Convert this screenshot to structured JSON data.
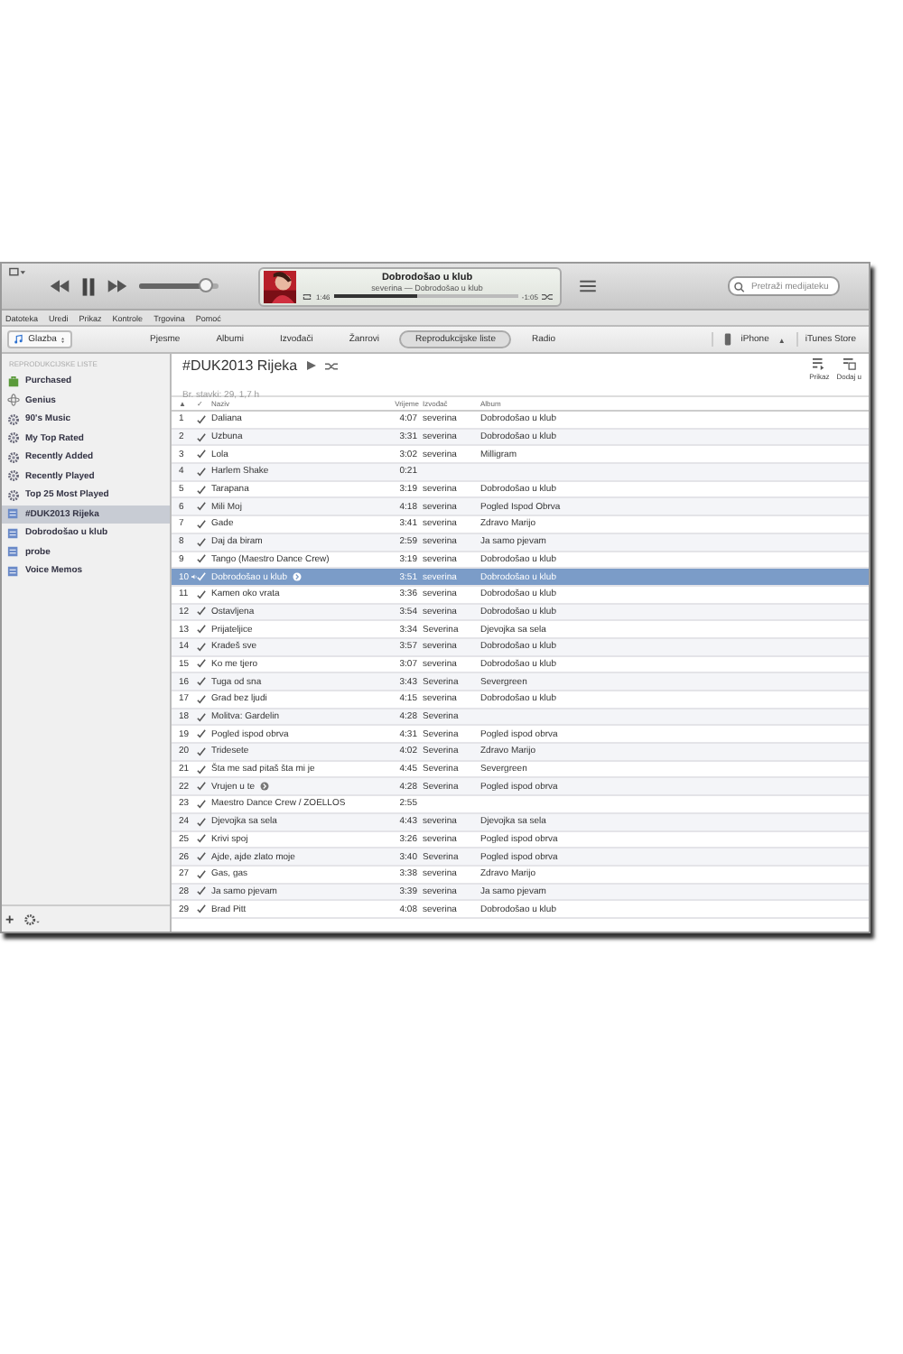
{
  "player": {
    "volume": {
      "level": 0.85
    },
    "now_playing": {
      "title": "Dobrodošao u klub",
      "subtitle": "severina — Dobrodošao u klub",
      "elapsed": "1:46",
      "remaining": "-1:05",
      "progress": {
        "level": 0.45
      }
    },
    "search": {
      "placeholder": "Pretraži medijateku"
    }
  },
  "menu": [
    "Datoteka",
    "Uredi",
    "Prikaz",
    "Kontrole",
    "Trgovina",
    "Pomoć"
  ],
  "library": {
    "label": "Glazba"
  },
  "nav_tabs": [
    {
      "label": "Pjesme",
      "selected": false
    },
    {
      "label": "Albumi",
      "selected": false
    },
    {
      "label": "Izvođači",
      "selected": false
    },
    {
      "label": "Žanrovi",
      "selected": false
    },
    {
      "label": "Reprodukcijske liste",
      "selected": true
    },
    {
      "label": "Radio",
      "selected": false
    }
  ],
  "device": {
    "label": "iPhone",
    "eject": "▲"
  },
  "store": {
    "label": "iTunes Store"
  },
  "sidebar": {
    "heading": "REPRODUKCIJSKE LISTE",
    "items": [
      {
        "label": "Purchased",
        "kind": "purchased",
        "selected": false
      },
      {
        "label": "Genius",
        "kind": "genius",
        "selected": false
      },
      {
        "label": "90's Music",
        "kind": "smart",
        "selected": false
      },
      {
        "label": "My Top Rated",
        "kind": "smart",
        "selected": false
      },
      {
        "label": "Recently Added",
        "kind": "smart",
        "selected": false
      },
      {
        "label": "Recently Played",
        "kind": "smart",
        "selected": false
      },
      {
        "label": "Top 25 Most Played",
        "kind": "smart",
        "selected": false
      },
      {
        "label": "#DUK2013 Rijeka",
        "kind": "playlist",
        "selected": true
      },
      {
        "label": "Dobrodošao u klub",
        "kind": "playlist",
        "selected": false
      },
      {
        "label": "probe",
        "kind": "playlist",
        "selected": false
      },
      {
        "label": "Voice Memos",
        "kind": "playlist",
        "selected": false
      }
    ],
    "add": "+"
  },
  "playlist": {
    "title": "#DUK2013 Rijeka",
    "info": "Br. stavki: 29, 1,7 h",
    "actions": [
      "Prikaz",
      "Dodaj u"
    ]
  },
  "table": {
    "columns": [
      "▲",
      "✓",
      "Naziv",
      "Vrijeme",
      "Izvođač",
      "Album"
    ],
    "rows": [
      {
        "n": "1",
        "name": "Daliana",
        "time": "4:07",
        "artist": "severina",
        "album": "Dobrodošao u klub",
        "checked": true,
        "selected": false,
        "playing": false,
        "arrow": false
      },
      {
        "n": "2",
        "name": "Uzbuna",
        "time": "3:31",
        "artist": "severina",
        "album": "Dobrodošao u klub",
        "checked": true,
        "selected": false,
        "playing": false,
        "arrow": false
      },
      {
        "n": "3",
        "name": "Lola",
        "time": "3:02",
        "artist": "severina",
        "album": "Milligram",
        "checked": true,
        "selected": false,
        "playing": false,
        "arrow": false
      },
      {
        "n": "4",
        "name": "Harlem Shake",
        "time": "0:21",
        "checked": true,
        "selected": false,
        "playing": false,
        "arrow": false
      },
      {
        "n": "5",
        "name": "Tarapana",
        "time": "3:19",
        "artist": "severina",
        "album": "Dobrodošao u klub",
        "checked": true,
        "selected": false,
        "playing": false,
        "arrow": false
      },
      {
        "n": "6",
        "name": "Mili Moj",
        "time": "4:18",
        "artist": "severina",
        "album": "Pogled Ispod Obrva",
        "checked": true,
        "selected": false,
        "playing": false,
        "arrow": false
      },
      {
        "n": "7",
        "name": "Gade",
        "time": "3:41",
        "artist": "severina",
        "album": "Zdravo Marijo",
        "checked": true,
        "selected": false,
        "playing": false,
        "arrow": false
      },
      {
        "n": "8",
        "name": "Daj da biram",
        "time": "2:59",
        "artist": "severina",
        "album": "Ja samo pjevam",
        "checked": true,
        "selected": false,
        "playing": false,
        "arrow": false
      },
      {
        "n": "9",
        "name": "Tango (Maestro Dance Crew)",
        "time": "3:19",
        "artist": "severina",
        "album": "Dobrodošao u klub",
        "checked": true,
        "selected": false,
        "playing": false,
        "arrow": false
      },
      {
        "n": "10",
        "name": "Dobrodošao u klub",
        "time": "3:51",
        "artist": "severina",
        "album": "Dobrodošao u klub",
        "checked": true,
        "selected": true,
        "playing": true,
        "arrow": true
      },
      {
        "n": "11",
        "name": "Kamen oko vrata",
        "time": "3:36",
        "artist": "severina",
        "album": "Dobrodošao u klub",
        "checked": true,
        "selected": false,
        "playing": false,
        "arrow": false
      },
      {
        "n": "12",
        "name": "Ostavljena",
        "time": "3:54",
        "artist": "severina",
        "album": "Dobrodošao u klub",
        "checked": true,
        "selected": false,
        "playing": false,
        "arrow": false
      },
      {
        "n": "13",
        "name": "Prijateljice",
        "time": "3:34",
        "artist": "Severina",
        "album": "Djevojka sa sela",
        "checked": true,
        "selected": false,
        "playing": false,
        "arrow": false
      },
      {
        "n": "14",
        "name": "Kradeš sve",
        "time": "3:57",
        "artist": "severina",
        "album": "Dobrodošao u klub",
        "checked": true,
        "selected": false,
        "playing": false,
        "arrow": false
      },
      {
        "n": "15",
        "name": "Ko me tjero",
        "time": "3:07",
        "artist": "severina",
        "album": "Dobrodošao u klub",
        "checked": true,
        "selected": false,
        "playing": false,
        "arrow": false
      },
      {
        "n": "16",
        "name": "Tuga od sna",
        "time": "3:43",
        "artist": "Severina",
        "album": "Severgreen",
        "checked": true,
        "selected": false,
        "playing": false,
        "arrow": false
      },
      {
        "n": "17",
        "name": "Grad bez ljudi",
        "time": "4:15",
        "artist": "severina",
        "album": "Dobrodošao u klub",
        "checked": true,
        "selected": false,
        "playing": false,
        "arrow": false
      },
      {
        "n": "18",
        "name": "Molitva: Gardelin",
        "time": "4:28",
        "artist": "Severina",
        "checked": true,
        "selected": false,
        "playing": false,
        "arrow": false
      },
      {
        "n": "19",
        "name": "Pogled ispod obrva",
        "time": "4:31",
        "artist": "Severina",
        "album": "Pogled ispod obrva",
        "checked": true,
        "selected": false,
        "playing": false,
        "arrow": false
      },
      {
        "n": "20",
        "name": "Tridesete",
        "time": "4:02",
        "artist": "Severina",
        "album": "Zdravo Marijo",
        "checked": true,
        "selected": false,
        "playing": false,
        "arrow": false
      },
      {
        "n": "21",
        "name": "Šta me sad pitaš šta mi je",
        "time": "4:45",
        "artist": "Severina",
        "album": "Severgreen",
        "checked": true,
        "selected": false,
        "playing": false,
        "arrow": false
      },
      {
        "n": "22",
        "name": "Vrujen u te",
        "time": "4:28",
        "artist": "Severina",
        "album": "Pogled ispod obrva",
        "checked": true,
        "selected": false,
        "playing": false,
        "arrow": true
      },
      {
        "n": "23",
        "name": "Maestro Dance Crew / ZOELLOS",
        "time": "2:55",
        "checked": true,
        "selected": false,
        "playing": false,
        "arrow": false
      },
      {
        "n": "24",
        "name": "Djevojka sa sela",
        "time": "4:43",
        "artist": "severina",
        "album": "Djevojka sa sela",
        "checked": true,
        "selected": false,
        "playing": false,
        "arrow": false
      },
      {
        "n": "25",
        "name": "Krivi spoj",
        "time": "3:26",
        "artist": "severina",
        "album": "Pogled ispod obrva",
        "checked": true,
        "selected": false,
        "playing": false,
        "arrow": false
      },
      {
        "n": "26",
        "name": "Ajde, ajde zlato moje",
        "time": "3:40",
        "artist": "Severina",
        "album": "Pogled ispod obrva",
        "checked": true,
        "selected": false,
        "playing": false,
        "arrow": false
      },
      {
        "n": "27",
        "name": "Gas, gas",
        "time": "3:38",
        "artist": "severina",
        "album": "Zdravo Marijo",
        "checked": true,
        "selected": false,
        "playing": false,
        "arrow": false
      },
      {
        "n": "28",
        "name": "Ja samo pjevam",
        "time": "3:39",
        "artist": "severina",
        "album": "Ja samo pjevam",
        "checked": true,
        "selected": false,
        "playing": false,
        "arrow": false
      },
      {
        "n": "29",
        "name": "Brad Pitt",
        "time": "4:08",
        "artist": "severina",
        "album": "Dobrodošao u klub",
        "checked": true,
        "selected": false,
        "playing": false,
        "arrow": false
      }
    ]
  }
}
